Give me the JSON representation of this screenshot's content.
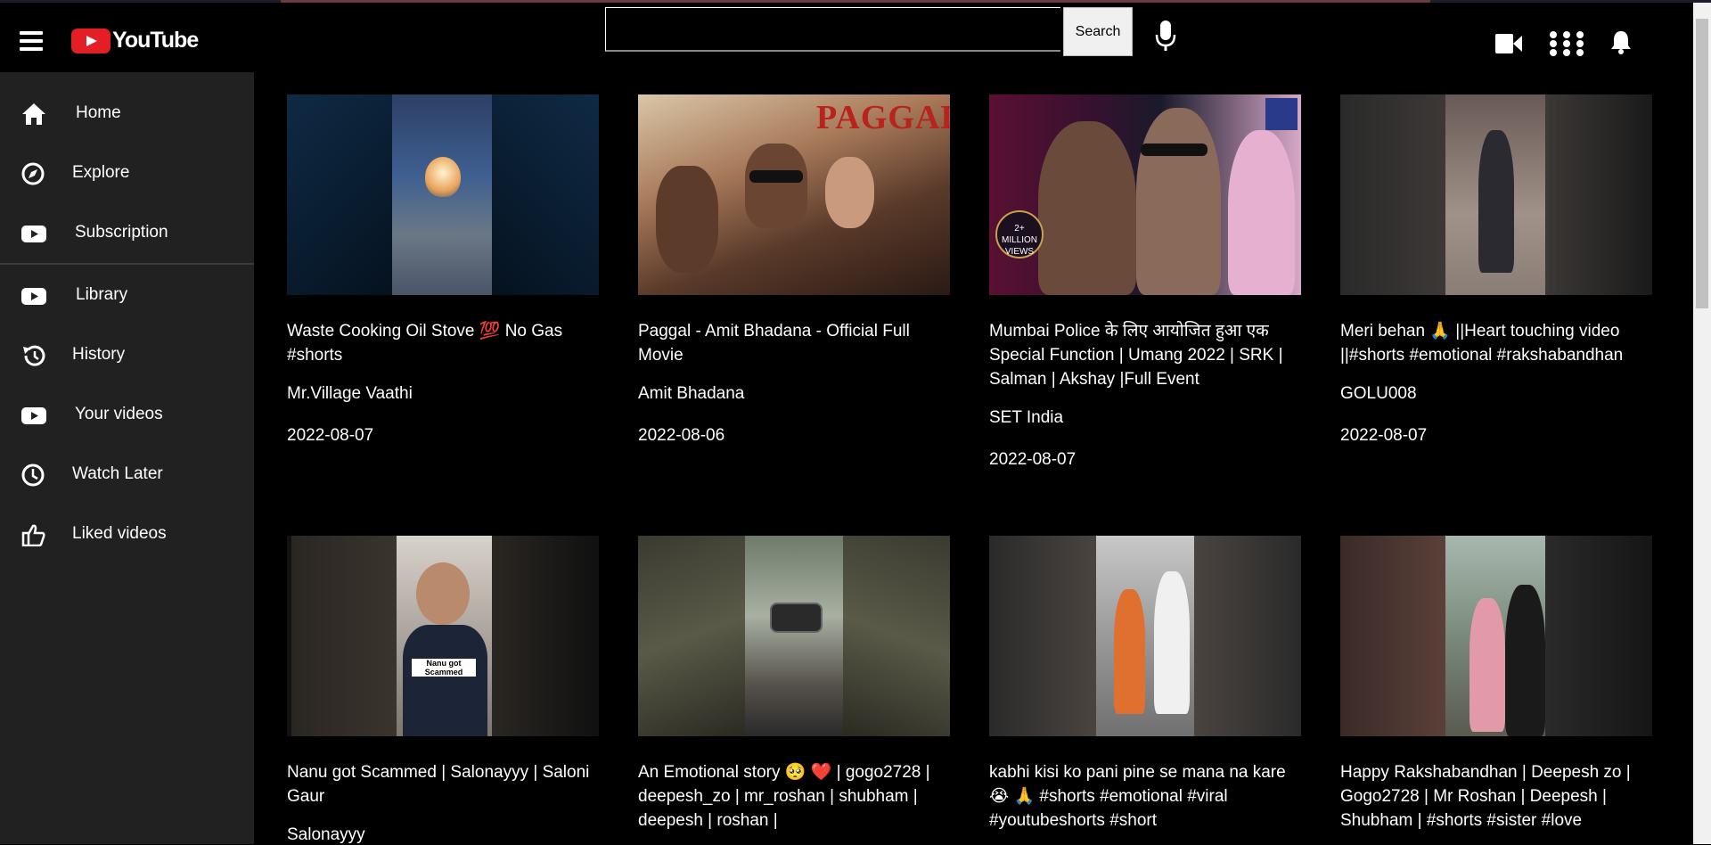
{
  "header": {
    "logo_text": "YouTube",
    "search": {
      "value": "",
      "button_label": "Search"
    }
  },
  "sidebar": {
    "items": [
      {
        "label": "Home",
        "icon": "home-icon"
      },
      {
        "label": "Explore",
        "icon": "compass-icon"
      },
      {
        "label": "Subscription",
        "icon": "play-icon"
      },
      {
        "label": "Library",
        "icon": "play-icon"
      },
      {
        "label": "History",
        "icon": "history-icon"
      },
      {
        "label": "Your videos",
        "icon": "play-icon"
      },
      {
        "label": "Watch Later",
        "icon": "clock-icon"
      },
      {
        "label": "Liked videos",
        "icon": "thumbs-up-icon"
      }
    ]
  },
  "videos": [
    {
      "title": "Waste Cooking Oil Stove 💯 No Gas #shorts",
      "channel": "Mr.Village Vaathi",
      "date": "2022-08-07"
    },
    {
      "title": "Paggal - Amit Bhadana - Official Full Movie",
      "channel": "Amit Bhadana",
      "date": "2022-08-06",
      "thumb_text": "PAGGAL"
    },
    {
      "title": "Mumbai Police के लिए आयोजित हुआ एक Special Function | Umang 2022 | SRK | Salman | Akshay |Full Event",
      "channel": "SET India",
      "date": "2022-08-07",
      "thumb_text": "2+ MILLION VIEWS"
    },
    {
      "title": "Meri behan 🙏 ||Heart touching video ||#shorts #emotional #rakshabandhan",
      "channel": "GOLU008",
      "date": "2022-08-07"
    },
    {
      "title": "Nanu got Scammed | Salonayyy | Saloni Gaur",
      "channel": "Salonayyy",
      "date": "",
      "thumb_text": "Nanu got Scammed"
    },
    {
      "title": "An Emotional story 🥺 ❤️ | gogo2728 | deepesh_zo | mr_roshan | shubham | deepesh | roshan |",
      "channel": "",
      "date": ""
    },
    {
      "title": "kabhi kisi ko pani pine se mana na kare 😭 🙏 #shorts #emotional #viral #youtubeshorts #short",
      "channel": "",
      "date": ""
    },
    {
      "title": "Happy Rakshabandhan | Deepesh zo | Gogo2728 | Mr Roshan | Deepesh | Shubham | #shorts #sister #love",
      "channel": "",
      "date": ""
    }
  ],
  "colors": {
    "background": "#000000",
    "sidebar": "#212121",
    "logo_red": "#e31e24"
  }
}
